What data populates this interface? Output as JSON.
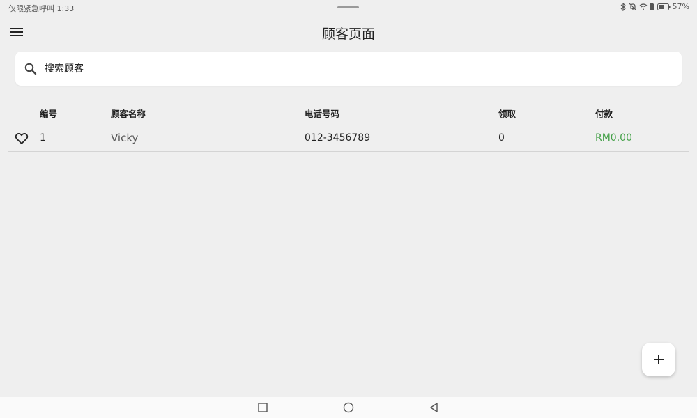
{
  "status_bar": {
    "left_text": "仅限紧急呼叫 1:33",
    "battery_percent": "57%",
    "icons": [
      "bluetooth-icon",
      "mute-icon",
      "wifi-icon",
      "sim-icon",
      "battery-icon"
    ]
  },
  "app_bar": {
    "menu_icon": "hamburger-menu-icon",
    "title": "顾客页面"
  },
  "search": {
    "icon": "search-icon",
    "placeholder": "搜索顾客",
    "value": ""
  },
  "table": {
    "columns": [
      "编号",
      "顾客名称",
      "电话号码",
      "领取",
      "付款"
    ],
    "rows": [
      {
        "favorite_icon": "heart-outline-icon",
        "id": "1",
        "name": "Vicky",
        "phone": "012-3456789",
        "collected": "0",
        "payment": "RM0.00"
      }
    ]
  },
  "fab": {
    "icon": "plus-icon"
  },
  "nav_bar": {
    "icons": [
      "square-recents-icon",
      "circle-home-icon",
      "triangle-back-icon"
    ]
  },
  "colors": {
    "background": "#efefef",
    "payment_green": "#43a047",
    "card": "#ffffff"
  }
}
